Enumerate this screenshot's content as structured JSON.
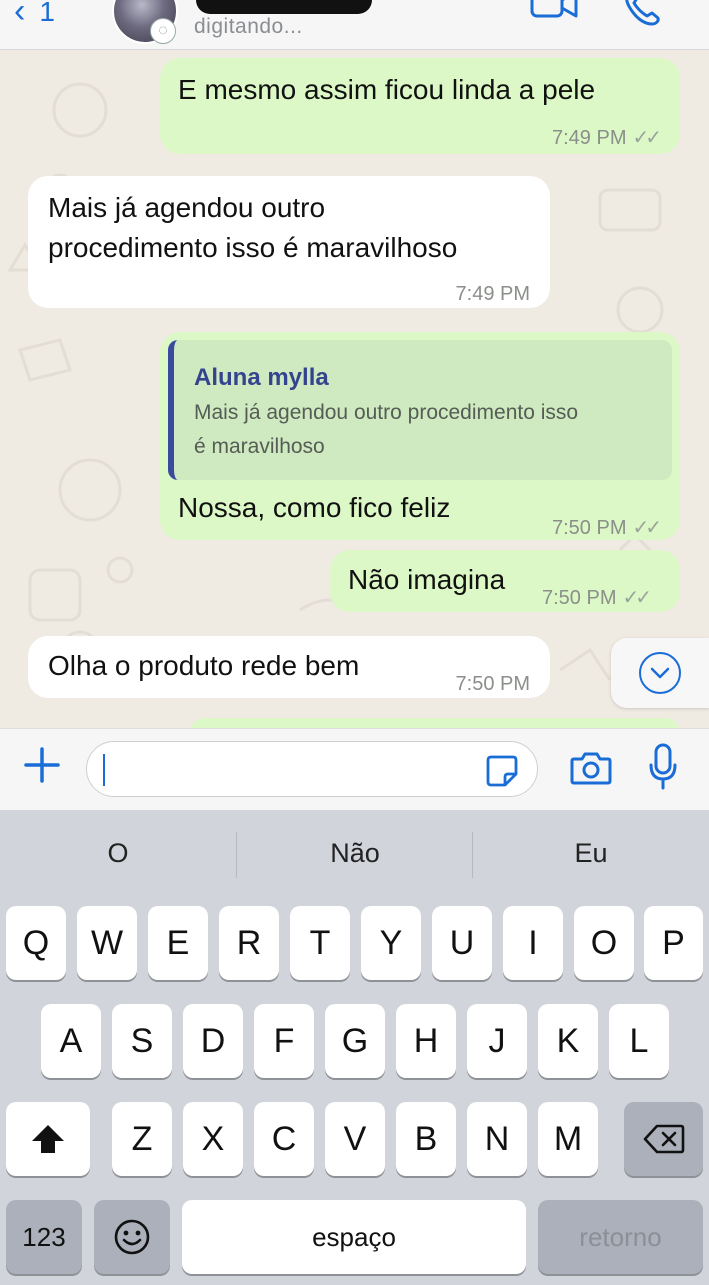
{
  "header": {
    "back_icon": "chevron-left-icon",
    "back_count": "1",
    "status": "digitando...",
    "video_icon": "video-camera-icon",
    "call_icon": "phone-icon"
  },
  "messages": [
    {
      "direction": "out",
      "text": "E mesmo assim ficou linda a pele",
      "time": "7:49 PM",
      "ticks": "✓✓"
    },
    {
      "direction": "in",
      "text_line1": "Mais já agendou outro",
      "text_line2": "procedimento isso é maravilhoso",
      "time": "7:49 PM"
    },
    {
      "direction": "out",
      "quote_name": "Aluna mylla",
      "quote_line1": "Mais já agendou outro procedimento isso",
      "quote_line2": "é maravilhoso",
      "text": "Nossa, como fico feliz",
      "time": "7:50 PM",
      "ticks": "✓✓"
    },
    {
      "direction": "out",
      "text": "Não imagina",
      "time": "7:50 PM",
      "ticks": "✓✓"
    },
    {
      "direction": "in",
      "text": "Olha o produto rede bem",
      "time": "7:50 PM"
    }
  ],
  "input": {
    "placeholder": "",
    "plus_icon": "plus-icon",
    "sticker_icon": "sticker-icon",
    "camera_icon": "camera-icon",
    "mic_icon": "microphone-icon"
  },
  "keyboard": {
    "suggestions": [
      "O",
      "Não",
      "Eu"
    ],
    "row1": [
      "Q",
      "W",
      "E",
      "R",
      "T",
      "Y",
      "U",
      "I",
      "O",
      "P"
    ],
    "row2": [
      "A",
      "S",
      "D",
      "F",
      "G",
      "H",
      "J",
      "K",
      "L"
    ],
    "row3": [
      "Z",
      "X",
      "C",
      "V",
      "B",
      "N",
      "M"
    ],
    "numbers_key": "123",
    "emoji_icon": "emoji-icon",
    "space_key": "espaço",
    "return_key": "retorno",
    "shift_icon": "shift-icon",
    "backspace_icon": "backspace-icon"
  },
  "colors": {
    "outgoing_bubble": "#dcf8c6",
    "incoming_bubble": "#ffffff",
    "chat_background": "#efeae2",
    "accent": "#1a6dd6",
    "quote_bar": "#3a4a9c"
  }
}
